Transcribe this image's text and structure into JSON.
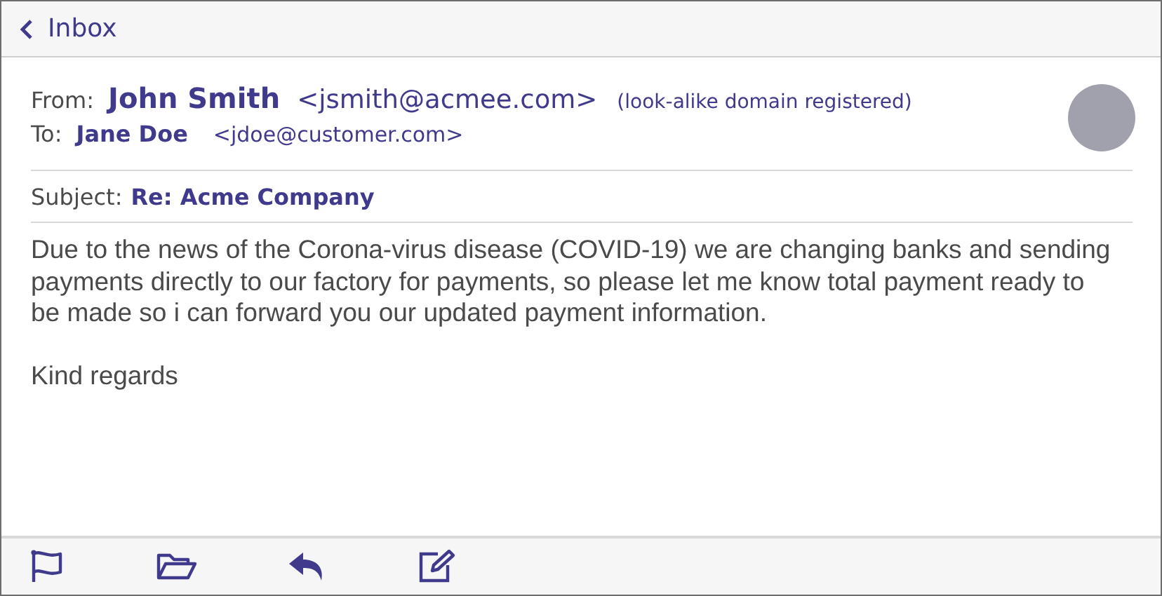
{
  "header": {
    "back_label": "Inbox"
  },
  "message": {
    "from_label": "From:",
    "from_name": "John Smith",
    "from_address": "<jsmith@acmee.com>",
    "from_note": "(look-alike domain registered)",
    "to_label": "To:",
    "to_name": "Jane Doe",
    "to_address": "<jdoe@customer.com>",
    "subject_label": "Subject:",
    "subject": "Re: Acme Company",
    "body": [
      "Due to the news of the Corona-virus disease (COVID-19) we are changing banks and sending payments directly to our factory for payments, so please let me know total payment ready to be made so i can forward you our updated payment information.",
      "Kind regards"
    ]
  }
}
